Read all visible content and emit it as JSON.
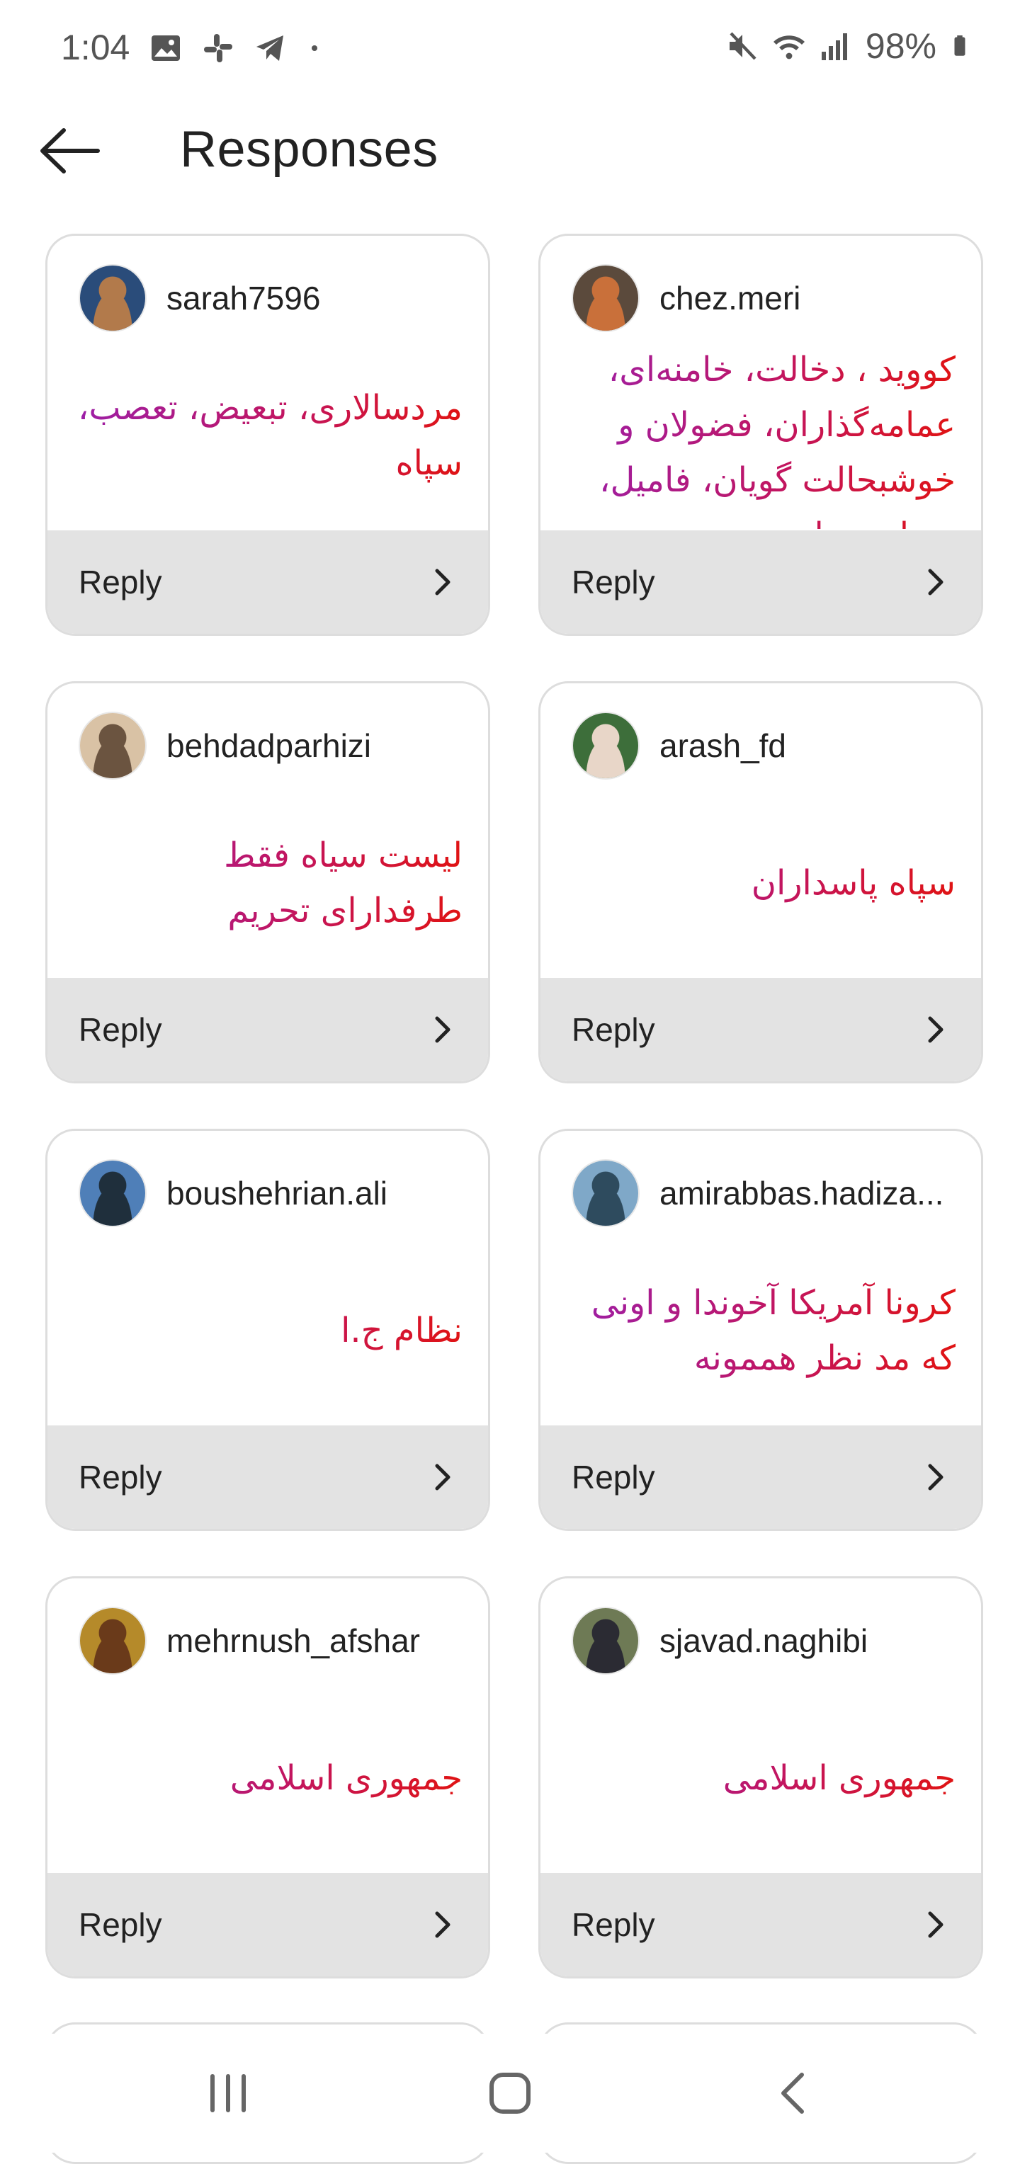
{
  "status_bar": {
    "time": "1:04",
    "battery": "98%",
    "left_icons": [
      "image-icon",
      "slack-icon",
      "telegram-icon",
      "dot-icon"
    ],
    "right_icons": [
      "mute-icon",
      "wifi-icon",
      "signal-icon",
      "battery-icon"
    ]
  },
  "header": {
    "back_icon": "arrow-left-icon",
    "title": "Responses"
  },
  "responses": [
    {
      "username": "sarah7596",
      "text": "مردسالاری، تبعیض، تعصب، سپاه",
      "reply_label": "Reply",
      "avatar_colors": [
        "#2a4c7a",
        "#b27a4b"
      ]
    },
    {
      "username": "chez.meri",
      "text": "کووید ، دخالت، خامنه‌ای، عمامه‌گذاران، فضولان و خوشبحالت گویان، فامیل، صداوسیما",
      "reply_label": "Reply",
      "avatar_colors": [
        "#5b4a3c",
        "#c9703a"
      ]
    },
    {
      "username": "behdadparhizi",
      "text": "لیست سیاه فقط طرفدارای تحریم",
      "reply_label": "Reply",
      "avatar_colors": [
        "#d9c2a5",
        "#6b5440"
      ]
    },
    {
      "username": "arash_fd",
      "text": "سپاه پاسداران",
      "reply_label": "Reply",
      "avatar_colors": [
        "#3d6e3a",
        "#e8d6c8"
      ]
    },
    {
      "username": "boushehrian.ali",
      "text": "نظام ج.ا",
      "reply_label": "Reply",
      "avatar_colors": [
        "#4f7fb8",
        "#1f2f3c"
      ]
    },
    {
      "username": "amirabbas.hadiza...",
      "text": "کرونا آمریکا آخوندا و اونی که مد نظر هممونه",
      "reply_label": "Reply",
      "avatar_colors": [
        "#7fa8c8",
        "#2e4b5e"
      ]
    },
    {
      "username": "mehrnush_afshar",
      "text": "جمهوری اسلامی",
      "reply_label": "Reply",
      "avatar_colors": [
        "#b58a2a",
        "#6a3a1a"
      ]
    },
    {
      "username": "sjavad.naghibi",
      "text": "جمهوری اسلامی",
      "reply_label": "Reply",
      "avatar_colors": [
        "#6e7a55",
        "#2b2b33"
      ]
    }
  ],
  "nav": {
    "recents_icon": "recents-icon",
    "home_icon": "home-icon",
    "back_icon": "back-chevron-icon"
  }
}
